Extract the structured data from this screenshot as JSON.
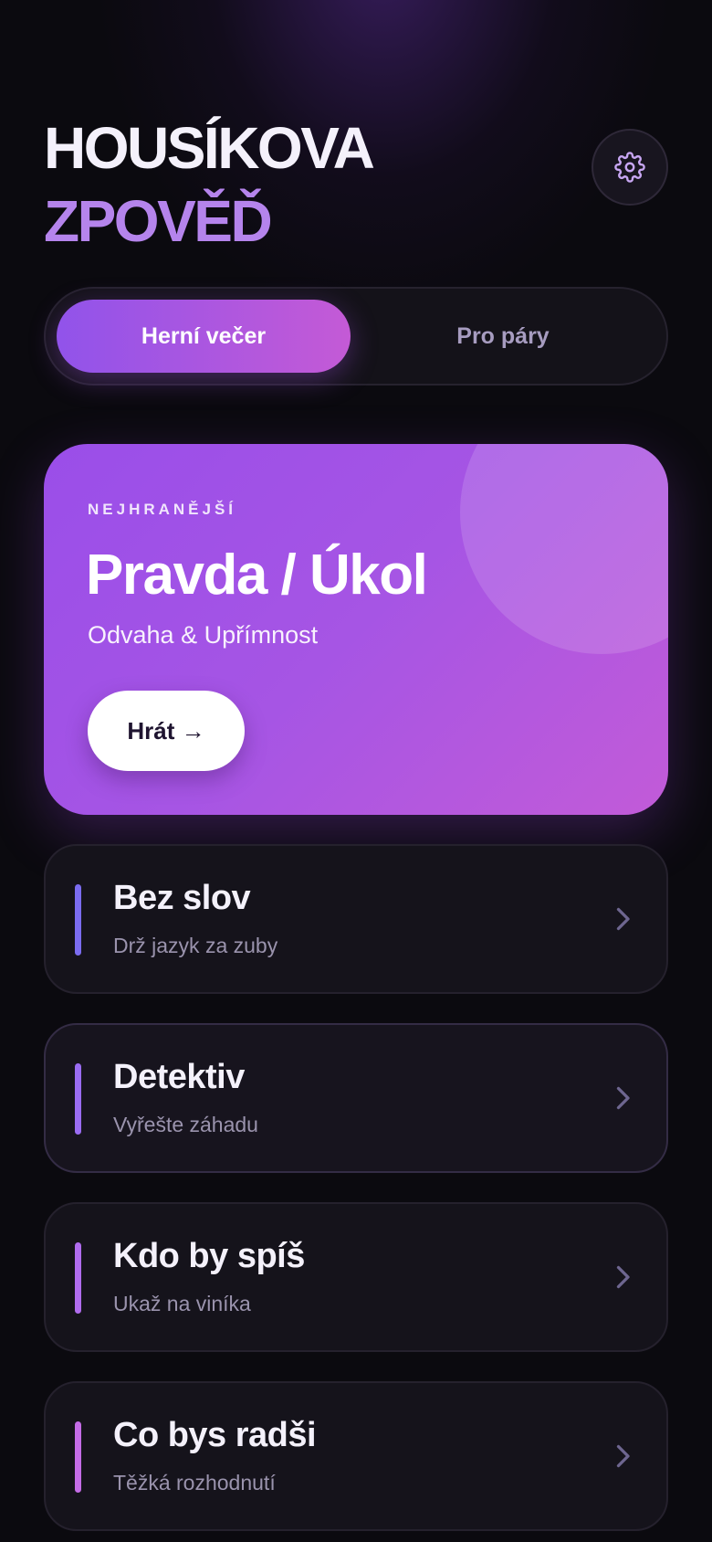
{
  "header": {
    "title_line1": "HOUSÍKOVA",
    "title_line2": "ZPOVĚĎ",
    "settings_icon": "gear-icon"
  },
  "mode_toggle": {
    "tabs": [
      {
        "label": "Herní večer",
        "active": true
      },
      {
        "label": "Pro páry",
        "active": false
      }
    ]
  },
  "featured": {
    "eyebrow": "NEJHRANĚJŠÍ",
    "title": "Pravda / Úkol",
    "subtitle": "Odvaha & Upřímnost",
    "play_label": "Hrát →"
  },
  "games": [
    {
      "title": "Bez slov",
      "subtitle": "Drž jazyk za zuby",
      "accent": "#7b6cf0"
    },
    {
      "title": "Detektiv",
      "subtitle": "Vyřešte záhadu",
      "accent": "#9a6cf2"
    },
    {
      "title": "Kdo by spíš",
      "subtitle": "Ukaž na viníka",
      "accent": "#b06cee"
    },
    {
      "title": "Co bys radši",
      "subtitle": "Těžká rozhodnutí",
      "accent": "#c46ce6"
    }
  ],
  "colors": {
    "background": "#0b0a0f",
    "accent_purple": "#b584ec",
    "card_gradient_start": "#9a4ee9",
    "card_gradient_end": "#c25bd8",
    "chevron": "#6e6690"
  }
}
